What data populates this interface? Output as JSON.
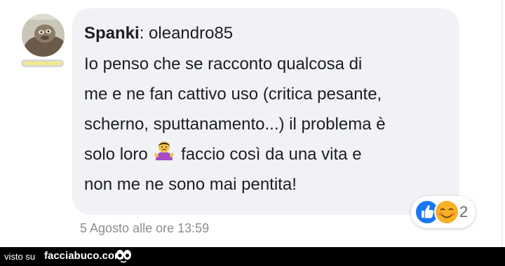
{
  "comment": {
    "author_name": "Spanki",
    "author_separator": ":",
    "mention": "oleandro85",
    "lines": [
      "Io penso che se racconto qualcosa di",
      "me e ne fan cattivo uso (critica pesante,",
      "scherno, sputtanamento...) il problema è",
      "faccio così da una vita e",
      "non me ne sono mai pentita!"
    ],
    "line4_prefix": "solo loro",
    "inline_emoji": "person-shrugging-emoji",
    "timestamp": "5 Agosto alle ore 13:59"
  },
  "reactions": {
    "count": "2",
    "icons": [
      "like-icon",
      "smiling-face-icon"
    ],
    "colors": {
      "like": "#1877f2",
      "smile": "#f7b125"
    }
  },
  "footer": {
    "visto_su": "visto su",
    "brand": "facciabuco.com"
  },
  "avatar": {
    "icon": "avatar-photo"
  },
  "badge": {
    "icon": "rank-badge-bar",
    "color": "#f2ea8a"
  }
}
